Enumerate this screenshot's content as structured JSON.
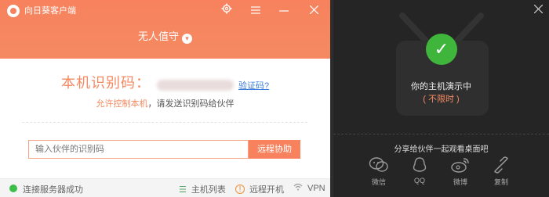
{
  "app": {
    "title": "向日葵客户端"
  },
  "toolbar": {
    "settings_icon": "gear-icon",
    "menu_icon": "hamburger-icon",
    "minimize_icon": "minimize-icon",
    "close_icon": "close-icon"
  },
  "header": {
    "mode": "无人值守"
  },
  "identity": {
    "label": "本机识别码：",
    "value": "",
    "verify_link": "验证码?"
  },
  "hint": {
    "allow": "允许控制本机",
    "rest": "，请发送识别码给伙伴"
  },
  "partner": {
    "placeholder": "输入伙伴的识别码",
    "button": "远程协助"
  },
  "footer": {
    "status": "连接服务器成功",
    "host_list": "主机列表",
    "remote_boot": "远程开机",
    "vpn": "VPN"
  },
  "demo_panel": {
    "status": "你的主机演示中",
    "limit": "( 不限时 )",
    "share_title": "分享给伙伴一起观看桌面吧",
    "shares": [
      {
        "label": "微信",
        "icon": "wechat-icon"
      },
      {
        "label": "QQ",
        "icon": "qq-icon"
      },
      {
        "label": "微博",
        "icon": "weibo-icon"
      },
      {
        "label": "复制",
        "icon": "link-icon"
      }
    ]
  },
  "colors": {
    "accent": "#f7825d",
    "success": "#3fb53c",
    "link": "#3b7ddd",
    "dark_bg": "#252525"
  }
}
